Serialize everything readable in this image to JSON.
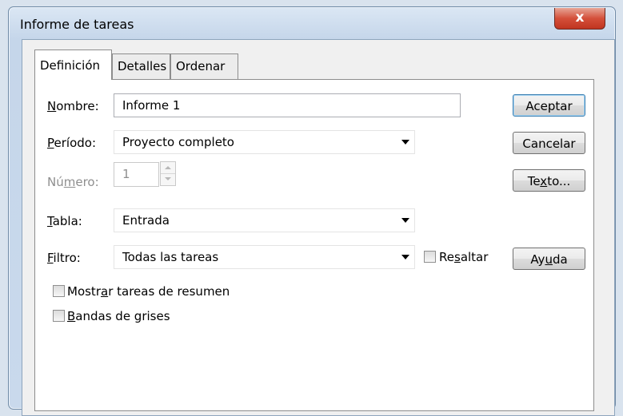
{
  "window": {
    "title": "Informe de tareas",
    "close_glyph": "x"
  },
  "tabs": [
    {
      "label": "Definición",
      "active": true
    },
    {
      "label": "Detalles",
      "active": false
    },
    {
      "label": "Ordenar",
      "active": false
    }
  ],
  "form": {
    "nombre": {
      "label_ul": "N",
      "label_rest": "ombre:",
      "value": "Informe 1"
    },
    "periodo": {
      "label_ul": "P",
      "label_rest": "eríodo:",
      "value": "Proyecto completo"
    },
    "numero": {
      "label_pre": "Nú",
      "label_ul": "m",
      "label_rest": "ero:",
      "value": "1",
      "disabled": true
    },
    "tabla": {
      "label_ul": "T",
      "label_rest": "abla:",
      "value": "Entrada"
    },
    "filtro": {
      "label_ul": "F",
      "label_rest": "iltro:",
      "value": "Todas las tareas"
    },
    "resaltar": {
      "label_pre": "Re",
      "label_ul": "s",
      "label_rest": "altar",
      "checked": false
    },
    "mostrar_resumen": {
      "label_pre": "Mostr",
      "label_ul": "a",
      "label_rest": "r tareas de resumen",
      "checked": false
    },
    "bandas_grises": {
      "label_ul": "B",
      "label_rest": "andas de grises",
      "checked": false
    }
  },
  "buttons": {
    "aceptar": "Aceptar",
    "cancelar": "Cancelar",
    "texto": {
      "pre": "Te",
      "ul": "x",
      "rest": "to..."
    },
    "ayuda": {
      "pre": "Ay",
      "ul": "u",
      "rest": "da"
    }
  }
}
